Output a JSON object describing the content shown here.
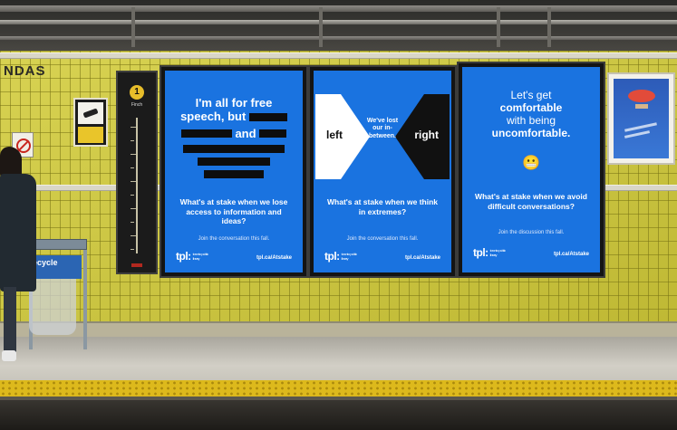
{
  "station": {
    "name": "NDAS"
  },
  "measure_post": {
    "number": "1",
    "label": "Finch"
  },
  "posters": [
    {
      "headline_lines": [
        "I'm all for free",
        "speech, but"
      ],
      "redacted_word_after": "and",
      "tagline": "What's at stake when we lose access to information and ideas?",
      "cta": "Join the conversation this fall.",
      "logo": "tpl:",
      "logo_sub": "toronto public library",
      "url": "tpl.ca/Atstake"
    },
    {
      "left_word": "left",
      "right_word": "right",
      "center_text": "We've lost our in-between.",
      "tagline": "What's at stake when we think in extremes?",
      "cta": "Join the conversation this fall.",
      "logo": "tpl:",
      "logo_sub": "toronto public library",
      "url": "tpl.ca/Atstake"
    },
    {
      "headline_lines": [
        "Let's get",
        "comfortable",
        "with being",
        "uncomfortable."
      ],
      "emoji": "😬",
      "tagline": "What's at stake when we avoid difficult conversations?",
      "cta": "Join the discussion this fall.",
      "logo": "tpl:",
      "logo_sub": "toronto public library",
      "url": "tpl.ca/Atstake"
    }
  ],
  "bin": {
    "label": "ecycle"
  },
  "colors": {
    "poster_blue": "#1a73e0",
    "tile_yellow": "#cfc838",
    "safety_yellow": "#ddb91c"
  }
}
